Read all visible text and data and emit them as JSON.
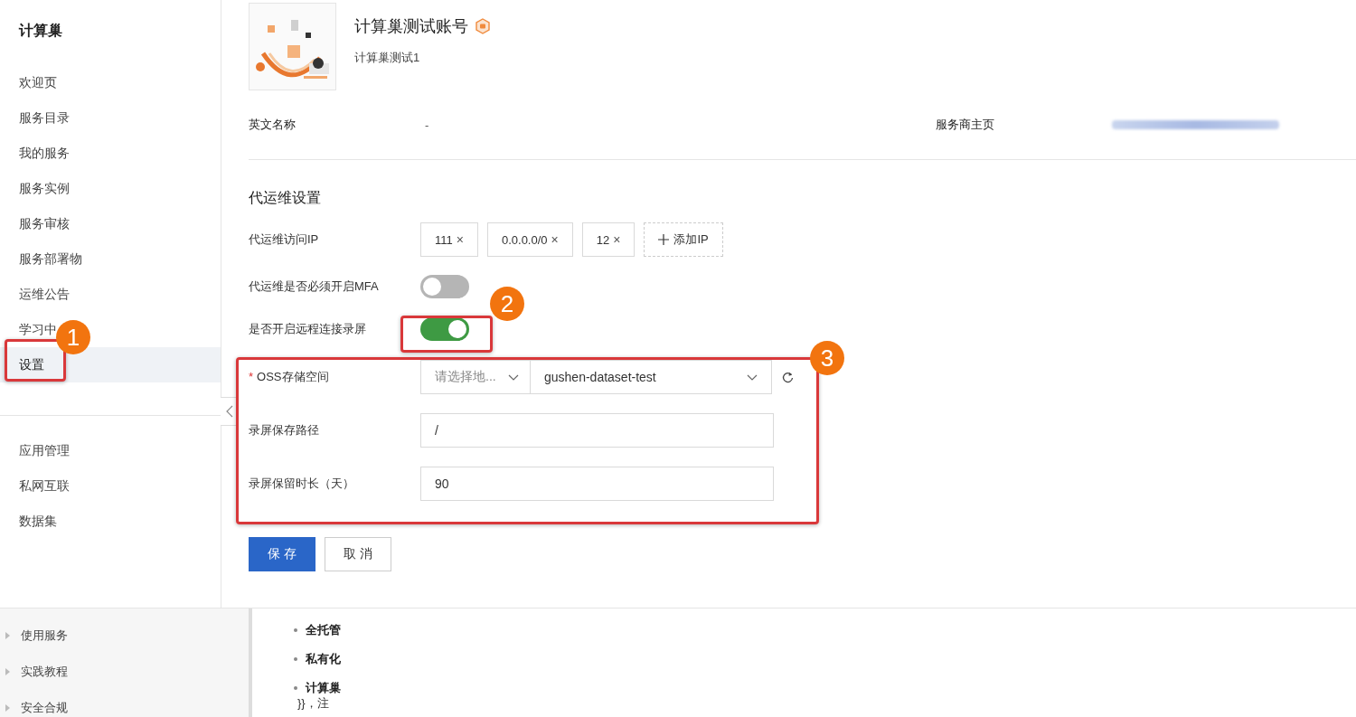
{
  "sidebar": {
    "title": "计算巢",
    "items": [
      {
        "label": "欢迎页",
        "selected": false
      },
      {
        "label": "服务目录",
        "selected": false
      },
      {
        "label": "我的服务",
        "selected": false
      },
      {
        "label": "服务实例",
        "selected": false
      },
      {
        "label": "服务审核",
        "selected": false
      },
      {
        "label": "服务部署物",
        "selected": false
      },
      {
        "label": "运维公告",
        "selected": false
      },
      {
        "label": "学习中",
        "selected": false
      },
      {
        "label": "设置",
        "selected": true
      }
    ],
    "items_2": [
      "应用管理",
      "私网互联",
      "数据集"
    ]
  },
  "service": {
    "name": "计算巢测试账号",
    "description": "计算巢测试1",
    "fields": [
      {
        "label": "英文名称",
        "value": "-"
      },
      {
        "label": "服务商主页",
        "kind": "blurred_link"
      }
    ]
  },
  "ops_settings": {
    "title": "代运维设置",
    "ip_label": "代运维访问IP",
    "ips": [
      {
        "text": "111",
        "remove": "×"
      },
      {
        "text": "0.0.0.0/0",
        "remove": "×"
      },
      {
        "text": "12",
        "remove": "×"
      }
    ],
    "add_ip": "添加IP",
    "toggles": [
      {
        "label": "代运维是否必须开启MFA",
        "on": false
      },
      {
        "label": "是否开启远程连接录屏",
        "on": true
      }
    ],
    "oss": {
      "required_mark": "*",
      "label": "OSS存储空间",
      "region_placeholder": "请选择地...",
      "bucket": "gushen-dataset-test"
    },
    "path": {
      "label": "录屏保存路径",
      "value": "/"
    },
    "retention": {
      "label": "录屏保留时长（天）",
      "value": "90"
    },
    "buttons": [
      {
        "label": "保 存",
        "kind": "primary"
      },
      {
        "label": "取 消",
        "kind": "default"
      }
    ]
  },
  "annotations": [
    "1",
    "2",
    "3"
  ],
  "doc": {
    "nav": [
      "使用服务",
      "实践教程",
      "安全合规"
    ],
    "bullets": [
      "全托管",
      "私有化",
      "计算巢"
    ],
    "text": "}}，注"
  }
}
